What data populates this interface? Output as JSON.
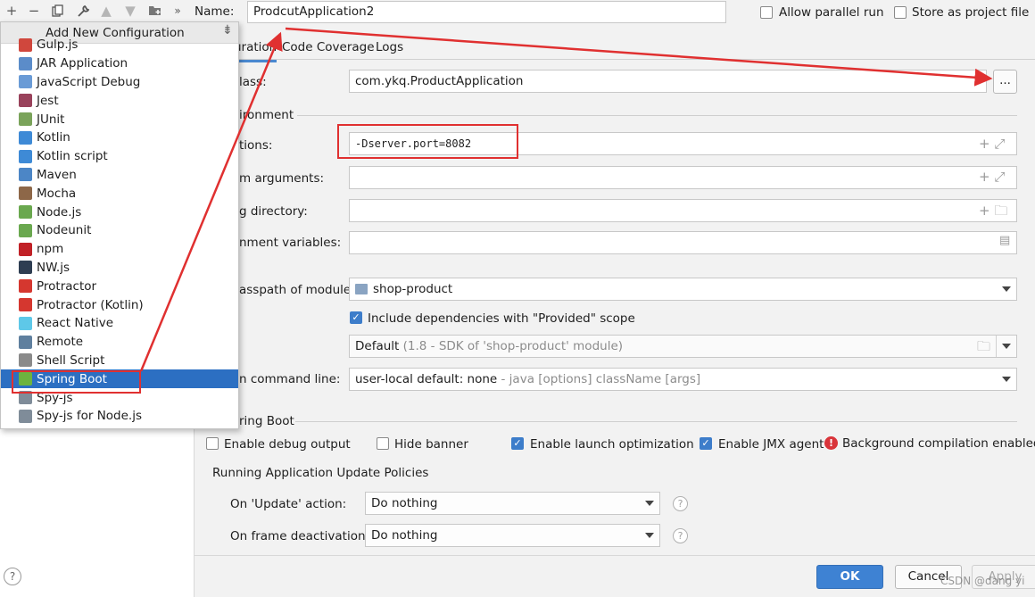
{
  "toolbar": {
    "icons": [
      "add-icon",
      "remove-icon",
      "copy-icon",
      "wrench-icon",
      "arrow-up-icon",
      "arrow-down-icon",
      "folder-add-icon",
      "more-icon"
    ],
    "name_label": "Name:",
    "name_value": "ProdcutApplication2",
    "allow_parallel_label": "Allow parallel run",
    "store_project_label": "Store as project file"
  },
  "tabs": [
    {
      "label": "Configuration",
      "visible": "uration"
    },
    {
      "label": "Code Coverage"
    },
    {
      "label": "Logs"
    }
  ],
  "form": {
    "main_class_label": "lass:",
    "main_class_value": "com.ykq.ProductApplication",
    "browse_label": "...",
    "environment_header": "ironment",
    "vm_options_label": "tions:",
    "vm_options_value": "-Dserver.port=8082",
    "program_args_label": "m arguments:",
    "working_dir_label": "g directory:",
    "env_vars_label": "nment variables:",
    "classpath_label": "asspath of module:",
    "classpath_value": "shop-product",
    "include_deps_label": "Include dependencies with \"Provided\" scope",
    "jre_value": "Default",
    "jre_hint": "(1.8 - SDK of 'shop-product' module)",
    "shorten_label": "n command line:",
    "shorten_value": "user-local default: none",
    "shorten_hint": "- java [options] className [args]"
  },
  "spring_boot": {
    "header": "ring Boot",
    "enable_debug": "Enable debug output",
    "hide_banner": "Hide banner",
    "launch_opt": "Enable launch optimization",
    "jmx_agent": "Enable JMX agent",
    "bg_compile": "Background compilation enabled",
    "policies_header": "Running Application Update Policies",
    "on_update_label": "On 'Update' action:",
    "on_update_value": "Do nothing",
    "on_frame_label": "On frame deactivation:",
    "on_frame_value": "Do nothing"
  },
  "popup": {
    "title": "Add New Configuration",
    "items": [
      {
        "label": "Gulp.js",
        "icon": "gulp-icon",
        "color": "#d0473d"
      },
      {
        "label": "JAR Application",
        "icon": "jar-icon",
        "color": "#5b8cc9"
      },
      {
        "label": "JavaScript Debug",
        "icon": "js-debug-icon",
        "color": "#6a9bd6"
      },
      {
        "label": "Jest",
        "icon": "jest-icon",
        "color": "#99425b"
      },
      {
        "label": "JUnit",
        "icon": "junit-icon",
        "color": "#7aa35a"
      },
      {
        "label": "Kotlin",
        "icon": "kotlin-icon",
        "color": "#3e8ad6"
      },
      {
        "label": "Kotlin script",
        "icon": "kotlin-script-icon",
        "color": "#3e8ad6"
      },
      {
        "label": "Maven",
        "icon": "maven-icon",
        "color": "#4c86c6"
      },
      {
        "label": "Mocha",
        "icon": "mocha-icon",
        "color": "#8d6748"
      },
      {
        "label": "Node.js",
        "icon": "nodejs-icon",
        "color": "#6aa84f"
      },
      {
        "label": "Nodeunit",
        "icon": "nodeunit-icon",
        "color": "#6aa84f"
      },
      {
        "label": "npm",
        "icon": "npm-icon",
        "color": "#c12127"
      },
      {
        "label": "NW.js",
        "icon": "nwjs-icon",
        "color": "#2e3d52"
      },
      {
        "label": "Protractor",
        "icon": "protractor-icon",
        "color": "#d5372f"
      },
      {
        "label": "Protractor (Kotlin)",
        "icon": "protractor-kotlin-icon",
        "color": "#d5372f"
      },
      {
        "label": "React Native",
        "icon": "react-icon",
        "color": "#5ec8e8"
      },
      {
        "label": "Remote",
        "icon": "remote-icon",
        "color": "#5f7f9e"
      },
      {
        "label": "Shell Script",
        "icon": "shell-icon",
        "color": "#8a8a8a"
      },
      {
        "label": "Spring Boot",
        "icon": "spring-boot-icon",
        "color": "#6db33f"
      },
      {
        "label": "Spy-js",
        "icon": "spyjs-icon",
        "color": "#7f8c99"
      },
      {
        "label": "Spy-js for Node.js",
        "icon": "spyjs-node-icon",
        "color": "#7f8c99"
      }
    ]
  },
  "buttons": {
    "ok": "OK",
    "cancel": "Cancel",
    "apply": "Apply",
    "help": "?"
  },
  "watermark": "CSDN @dang yi",
  "colors": {
    "selection": "#2c6fc2",
    "annotation": "#e03030",
    "ok_button": "#3e82d3"
  }
}
